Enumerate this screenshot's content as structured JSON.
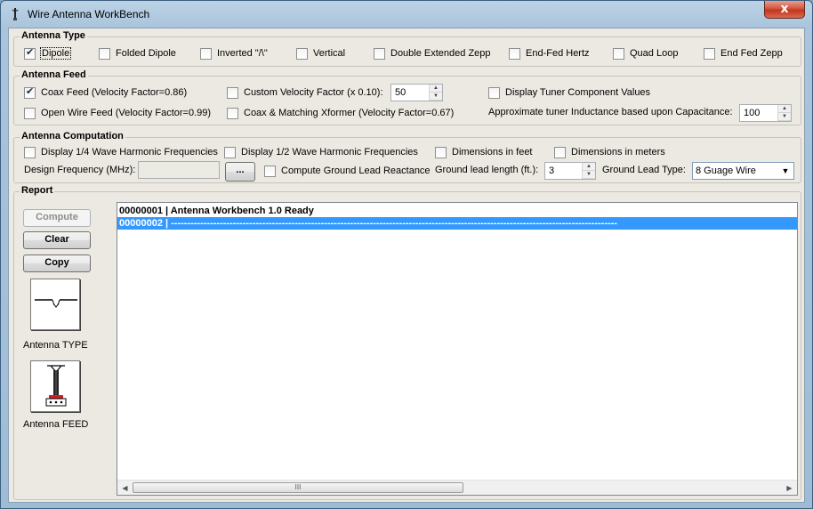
{
  "window": {
    "title": "Wire Antenna WorkBench",
    "close_glyph": "x"
  },
  "antenna_type": {
    "title": "Antenna Type",
    "options": [
      {
        "label": "Dipole",
        "checked": true
      },
      {
        "label": "Folded Dipole",
        "checked": false
      },
      {
        "label": "Inverted \"/\\\"",
        "checked": false
      },
      {
        "label": "Vertical",
        "checked": false
      },
      {
        "label": "Double Extended Zepp",
        "checked": false
      },
      {
        "label": "End-Fed Hertz",
        "checked": false
      },
      {
        "label": "Quad Loop",
        "checked": false
      },
      {
        "label": "End Fed Zepp",
        "checked": false
      }
    ]
  },
  "antenna_feed": {
    "title": "Antenna Feed",
    "coax_feed": {
      "label": "Coax Feed (Velocity Factor=0.86)",
      "checked": true
    },
    "open_wire_feed": {
      "label": "Open Wire Feed (Velocity Factor=0.99)",
      "checked": false
    },
    "custom_velocity": {
      "label": "Custom Velocity Factor (x 0.10):",
      "checked": false,
      "value": "50"
    },
    "coax_matching": {
      "label": "Coax & Matching Xformer (Velocity Factor=0.67)",
      "checked": false
    },
    "display_tuner": {
      "label": "Display Tuner Component Values",
      "checked": false
    },
    "tuner_inductance": {
      "label": "Approximate tuner Inductance based upon Capacitance:",
      "value": "100"
    }
  },
  "antenna_computation": {
    "title": "Antenna Computation",
    "quarter_wave": {
      "label": "Display 1/4 Wave Harmonic Frequencies",
      "checked": false
    },
    "half_wave": {
      "label": "Display 1/2 Wave Harmonic Frequencies",
      "checked": false
    },
    "dim_feet": {
      "label": "Dimensions in feet",
      "checked": false
    },
    "dim_meters": {
      "label": "Dimensions in meters",
      "checked": false
    },
    "design_frequency": {
      "label": "Design Frequency (MHz):",
      "value": ""
    },
    "browse_label": "...",
    "ground_reactance": {
      "label": "Compute Ground Lead Reactance",
      "checked": false
    },
    "ground_length": {
      "label": "Ground lead length (ft.):",
      "value": "3"
    },
    "ground_type": {
      "label": "Ground Lead Type:",
      "value": "8 Guage Wire"
    }
  },
  "report": {
    "title": "Report",
    "compute_label": "Compute",
    "clear_label": "Clear",
    "copy_label": "Copy",
    "type_caption": "Antenna TYPE",
    "feed_caption": "Antenna FEED",
    "log": [
      "00000001 | Antenna Workbench 1.0 Ready",
      "00000002 | -----------------------------------------------------------------------------------------------------------------------------------------"
    ],
    "scroll_grip": "III"
  }
}
